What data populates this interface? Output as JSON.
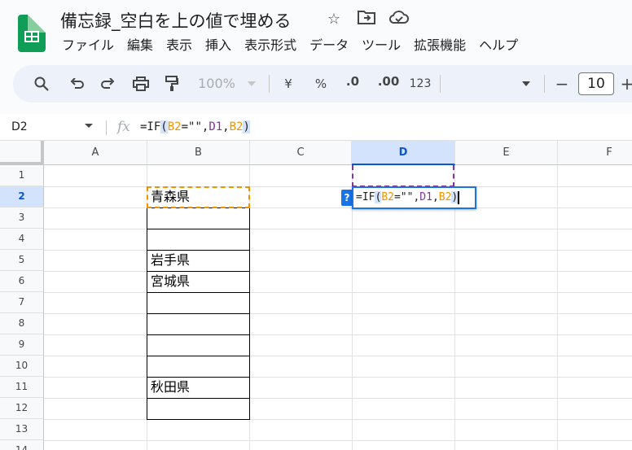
{
  "title": "備忘録_空白を上の値で埋める",
  "title_icons": [
    "star-icon",
    "move-to-folder-icon",
    "cloud-saved-icon"
  ],
  "menu": [
    "ファイル",
    "編集",
    "表示",
    "挿入",
    "表示形式",
    "データ",
    "ツール",
    "拡張機能",
    "ヘルプ"
  ],
  "toolbar": {
    "zoom": "100%",
    "currency": "¥",
    "percent": "%",
    "decrease_decimal": ".0",
    "increase_decimal": ".00",
    "number_format": "123",
    "font_size": "10",
    "minus": "−",
    "plus": "+"
  },
  "formula_bar": {
    "name_box": "D2",
    "fx": "fx",
    "formula_parts": [
      "=IF",
      "(",
      "B2",
      "=\"\",",
      "D1",
      ",",
      "B2",
      ")"
    ]
  },
  "columns": [
    "A",
    "B",
    "C",
    "D",
    "E",
    "F"
  ],
  "selected_column": "D",
  "rows": [
    "1",
    "2",
    "3",
    "4",
    "5",
    "6",
    "7",
    "8",
    "9",
    "10",
    "11",
    "12",
    "13",
    "14"
  ],
  "selected_row": "2",
  "cells": {
    "B2": "青森県",
    "B5": "岩手県",
    "B6": "宮城県",
    "B11": "秋田県"
  },
  "editor": {
    "help_badge": "?",
    "formula_parts": [
      "=IF",
      "(",
      "B2",
      "=\"\",",
      "D1",
      ",",
      "B2",
      ")"
    ]
  },
  "colors": {
    "b2_reference": "#f09300",
    "d1_reference": "#7e3794",
    "selection": "#1a73e8",
    "sheets_logo": "#0f9d58"
  }
}
